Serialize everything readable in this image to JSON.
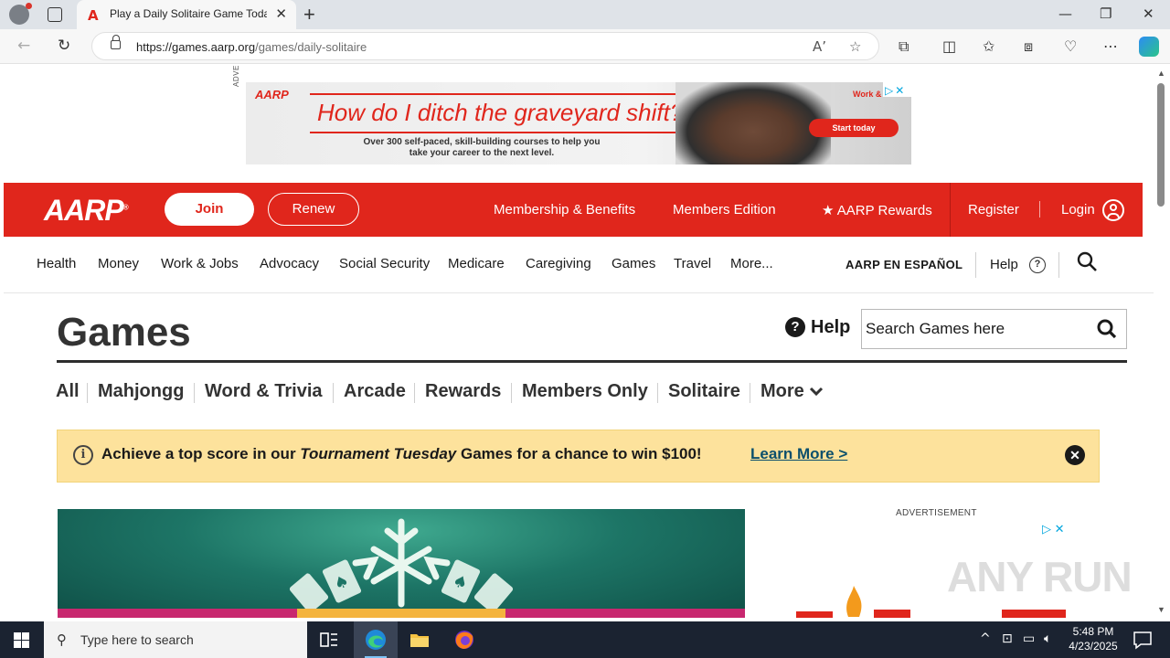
{
  "browser": {
    "tab_title": "Play a Daily Solitaire Game Today",
    "tab_favicon": "A",
    "url_host": "https://games.aarp.org",
    "url_path": "/games/daily-solitaire"
  },
  "ad_top": {
    "label": "ADVERTISEMENT",
    "brand": "AARP",
    "headline": "How do I ditch the graveyard shift?",
    "subtext": "Over 300 self-paced, skill-building courses to help you take your career to the next level.",
    "work_label": "Work &",
    "cta": "Start today"
  },
  "header": {
    "logo": "AARP",
    "join": "Join",
    "renew": "Renew",
    "membership": "Membership & Benefits",
    "members_edition": "Members Edition",
    "rewards": "AARP Rewards",
    "register": "Register",
    "login": "Login"
  },
  "subnav": {
    "items": [
      "Health",
      "Money",
      "Work & Jobs",
      "Advocacy",
      "Social Security",
      "Medicare",
      "Caregiving",
      "Games",
      "Travel",
      "More..."
    ],
    "espanol": "AARP EN ESPAÑOL",
    "help": "Help"
  },
  "games": {
    "title": "Games",
    "help": "Help",
    "search_placeholder": "Search Games here",
    "categories": [
      "All",
      "Mahjongg",
      "Word & Trivia",
      "Arcade",
      "Rewards",
      "Members Only",
      "Solitaire",
      "More"
    ]
  },
  "notice": {
    "text_before": "Achieve a top score in our ",
    "text_em": "Tournament Tuesday",
    "text_after": " Games for a chance to win $100!",
    "link": "Learn More >"
  },
  "side_ad": {
    "label": "ADVERTISEMENT"
  },
  "watermark": "ANY RUN",
  "taskbar": {
    "search_placeholder": "Type here to search",
    "time": "5:48 PM",
    "date": "4/23/2025"
  },
  "colors": {
    "aarp_red": "#e0261c",
    "notice_yellow": "#fde29c",
    "taskbar": "#1b2331"
  }
}
